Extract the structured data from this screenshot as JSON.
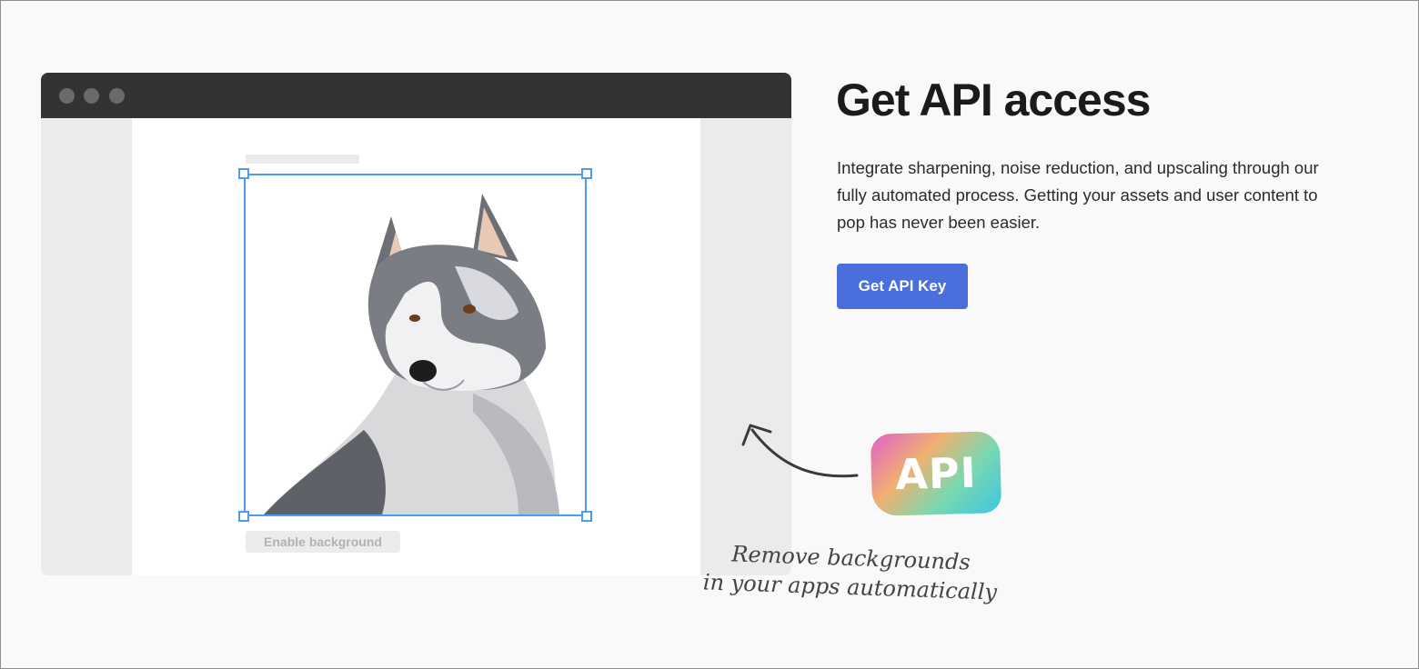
{
  "mockup": {
    "enable_background_label": "Enable background"
  },
  "hero": {
    "title": "Get API access",
    "description": "Integrate sharpening, noise reduction, and upscaling through our fully automated process. Getting your assets and user content to pop has never been easier.",
    "cta_label": "Get API Key"
  },
  "badge": {
    "label": "API"
  },
  "caption": {
    "line1": "Remove backgrounds",
    "line2": "in your apps automatically"
  },
  "colors": {
    "accent": "#4a6fdd",
    "selection": "#4c9cf0",
    "titlebar": "#333333"
  },
  "icons": [
    "curved-arrow-icon"
  ]
}
